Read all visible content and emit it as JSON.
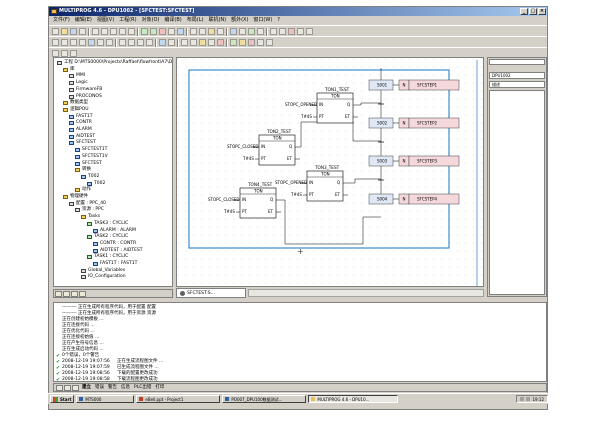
{
  "window": {
    "title": "MULTIPROG 4.6 - DPU1002 - [SFCTEST:SFCTEST]",
    "controls": [
      "_",
      "□",
      "×"
    ]
  },
  "menu": [
    "文件(F)",
    "编辑(E)",
    "视图(V)",
    "工程(R)",
    "对象(O)",
    "编译(B)",
    "布局(L)",
    "联机(N)",
    "额外(X)",
    "窗口(W)",
    "?"
  ],
  "project_tree": [
    {
      "label": "工程  D:\\MTS0000\\Projects\\Raffael\\flowfront\\A7\\DPU1002",
      "depth": 0,
      "icon": "conf"
    },
    {
      "label": "库",
      "depth": 1,
      "icon": "folder"
    },
    {
      "label": "MMI",
      "depth": 2,
      "icon": "conf"
    },
    {
      "label": "Logic",
      "depth": 2,
      "icon": "conf"
    },
    {
      "label": "FirmwareFB",
      "depth": 2,
      "icon": "conf"
    },
    {
      "label": "PROCONOS",
      "depth": 2,
      "icon": "conf"
    },
    {
      "label": "数据类型",
      "depth": 1,
      "icon": "folder"
    },
    {
      "label": "逻辑POU",
      "depth": 1,
      "icon": "folder"
    },
    {
      "label": "FAST1T",
      "depth": 2,
      "icon": "pou"
    },
    {
      "label": "CONTR",
      "depth": 2,
      "icon": "pou"
    },
    {
      "label": "ALARM",
      "depth": 2,
      "icon": "pou"
    },
    {
      "label": "AIDTEST",
      "depth": 2,
      "icon": "pou"
    },
    {
      "label": "SFCTEST",
      "depth": 2,
      "icon": "pou"
    },
    {
      "label": "SFCTEST1T",
      "depth": 3,
      "icon": "pou"
    },
    {
      "label": "SFCTEST1V",
      "depth": 3,
      "icon": "pou"
    },
    {
      "label": "SFCTEST",
      "depth": 3,
      "icon": "pou"
    },
    {
      "label": "转换",
      "depth": 3,
      "icon": "folder"
    },
    {
      "label": "T002",
      "depth": 4,
      "icon": "pou"
    },
    {
      "label": "T002",
      "depth": 5,
      "icon": "pou"
    },
    {
      "label": "动作",
      "depth": 3,
      "icon": "folder"
    },
    {
      "label": "物理硬件",
      "depth": 1,
      "icon": "folder"
    },
    {
      "label": "配置 : PPC_40",
      "depth": 2,
      "icon": "conf"
    },
    {
      "label": "资源 : PPC",
      "depth": 3,
      "icon": "conf"
    },
    {
      "label": "Tasks",
      "depth": 4,
      "icon": "folder"
    },
    {
      "label": "TASK3 : CYCLIC",
      "depth": 5,
      "icon": "task"
    },
    {
      "label": "ALARM : ALARM",
      "depth": 6,
      "icon": "pou"
    },
    {
      "label": "TASK2 : CYCLIC",
      "depth": 5,
      "icon": "task"
    },
    {
      "label": "CONTR : CONTR",
      "depth": 6,
      "icon": "pou"
    },
    {
      "label": "AIDTEST : AIDTEST",
      "depth": 6,
      "icon": "pou"
    },
    {
      "label": "TASK1 : CYCLIC",
      "depth": 5,
      "icon": "task"
    },
    {
      "label": "FAST1T : FAST1T",
      "depth": 6,
      "icon": "pou"
    },
    {
      "label": "Global_Variables",
      "depth": 4,
      "icon": "conf"
    },
    {
      "label": "IO_Configuration",
      "depth": 4,
      "icon": "conf"
    }
  ],
  "diagram": {
    "timers": [
      {
        "name": "TON1_TEST",
        "type": "TON",
        "in_var": "STOPC_OPENED",
        "pt_var": "T#4S",
        "pin_in": "IN",
        "pin_q": "Q",
        "pin_pt": "PT",
        "pin_et": "ET"
      },
      {
        "name": "TON2_TEST",
        "type": "TON",
        "in_var": "STOPC_CLOSED",
        "pt_var": "T#4S",
        "pin_in": "IN",
        "pin_q": "Q",
        "pin_pt": "PT",
        "pin_et": "ET"
      },
      {
        "name": "TON3_TEST",
        "type": "TON",
        "in_var": "STOPC_OPENED",
        "pt_var": "T#4S",
        "pin_in": "IN",
        "pin_q": "Q",
        "pin_pt": "PT",
        "pin_et": "ET"
      },
      {
        "name": "TON4_TEST",
        "type": "TON",
        "in_var": "STOPC_CLOSED",
        "pt_var": "T#4S",
        "pin_in": "IN",
        "pin_q": "Q",
        "pin_pt": "PT",
        "pin_et": "ET"
      }
    ],
    "steps": [
      {
        "step": "S001",
        "qual": "N",
        "action": "SFCSTEP1"
      },
      {
        "step": "S002",
        "qual": "N",
        "action": "SFCSTEP2"
      },
      {
        "step": "S003",
        "qual": "N",
        "action": "SFCSTEP3"
      },
      {
        "step": "S004",
        "qual": "N",
        "action": "SFCSTEP4"
      }
    ]
  },
  "editor_tab": "SFCTEST:S...",
  "right_panel": {
    "header": "",
    "field1": "DPU1002",
    "field2": "描述"
  },
  "messages": [
    {
      "a": "---------  正在生成所有程序代码，用于配置 配置",
      "b": ""
    },
    {
      "a": "---------  正在生成所有程序代码，用于资源 资源",
      "b": ""
    },
    {
      "a": "正在创建初始模板 ...",
      "b": ""
    },
    {
      "a": "正在连接代码 ...",
      "b": ""
    },
    {
      "a": "正在优化代码 ...",
      "b": ""
    },
    {
      "a": "正在连接初始值 ...",
      "b": ""
    },
    {
      "a": "正在产生符号信息 ...",
      "b": ""
    },
    {
      "a": "正在生成启动代码 ...",
      "b": ""
    },
    {
      "a": "0个错误，0个警告",
      "b": ""
    },
    {
      "a": "2008-12-19 19:07:56",
      "b": "正在生成流程图文件 ..."
    },
    {
      "a": "2008-12-19 19:07:59",
      "b": "已生成流程图文件 ..."
    },
    {
      "a": "2008-12-19 19:08:56",
      "b": "下载的配置更改成功"
    },
    {
      "a": "2008-12-19 19:08:58",
      "b": "下载流程图更改成功"
    }
  ],
  "msg_tabs": [
    "建立",
    "错误",
    "警告",
    "信息",
    "PLC出错",
    "打印"
  ],
  "status": {
    "left": "帮助信息，请按F1",
    "right": "MUSE  ID:32GB"
  },
  "taskbar": {
    "start": "Start",
    "items": [
      "MTS000",
      "eBell.ppt - Project1",
      "PO007_DPU100数据测试...",
      "MULTIPROG 4.6 - DPU10..."
    ],
    "clock": "19:12"
  }
}
